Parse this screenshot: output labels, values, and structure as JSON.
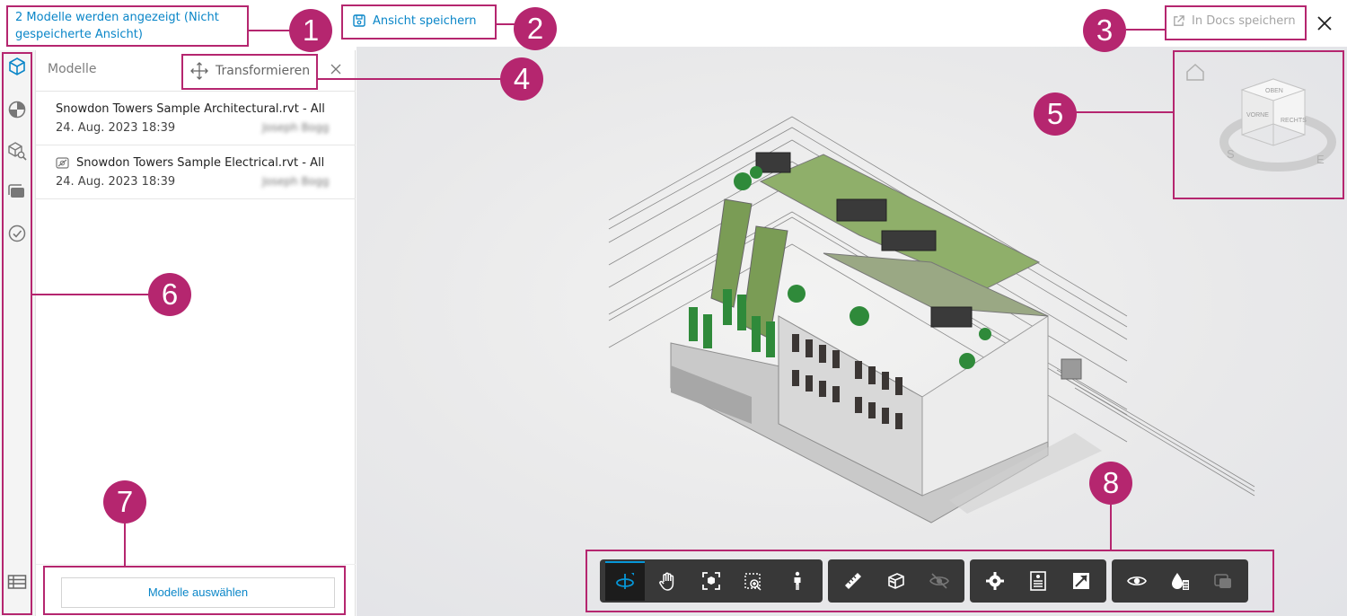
{
  "header": {
    "status_text": "2 Modelle werden angezeigt (Nicht gespeicherte Ansicht)",
    "save_view_label": "Ansicht speichern",
    "save_docs_label": "In Docs speichern"
  },
  "panel": {
    "title": "Modelle",
    "transform_label": "Transformieren",
    "models": [
      {
        "name": "Snowdon Towers Sample Architectural.rvt - All",
        "date": "24. Aug. 2023 18:39",
        "user": "Joseph Bogg"
      },
      {
        "name": "Snowdon Towers Sample Electrical.rvt - All",
        "date": "24. Aug. 2023 18:39",
        "user": "Joseph Bogg"
      }
    ],
    "select_models_label": "Modelle auswählen"
  },
  "sidebar": {
    "icons": [
      "models-cube-icon",
      "pie-icon",
      "search-model-icon",
      "layers-icon",
      "check-circle-icon",
      "table-icon"
    ]
  },
  "viewcube": {
    "faces": [
      "OBEN",
      "VORNE",
      "RECHTS"
    ],
    "compass": [
      "S",
      "E"
    ]
  },
  "toolbar": {
    "groups": [
      [
        "orbit-icon",
        "pan-icon",
        "fit-to-view-icon",
        "zoom-window-icon",
        "first-person-icon"
      ],
      [
        "measure-icon",
        "section-box-icon",
        "hide-icon"
      ],
      [
        "settings-icon",
        "properties-icon",
        "fullscreen-icon"
      ],
      [
        "visibility-icon",
        "theming-icon",
        "ghost-icon"
      ]
    ],
    "active": "orbit-icon"
  },
  "annotations": {
    "callouts": [
      "1",
      "2",
      "3",
      "4",
      "5",
      "6",
      "7",
      "8"
    ],
    "color": "#b5266f"
  },
  "colors": {
    "accent": "#0a86c8",
    "toolbar_bg": "#383838"
  }
}
